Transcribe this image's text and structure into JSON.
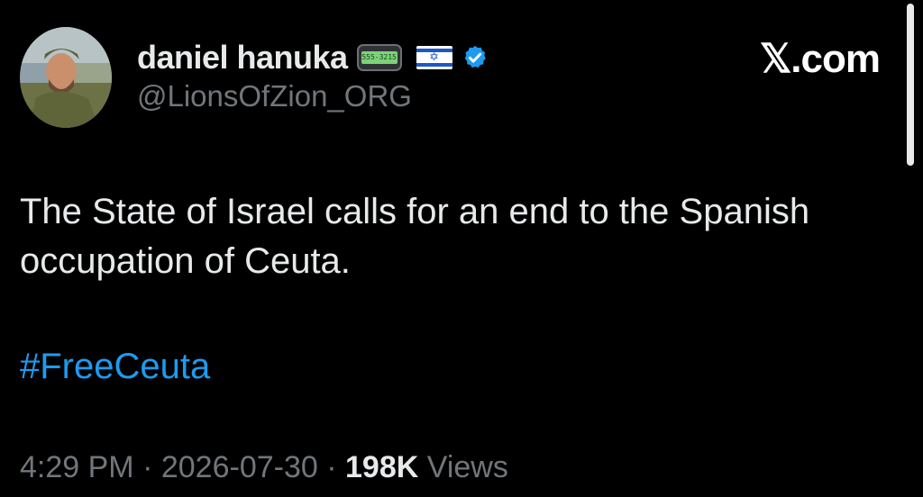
{
  "author": {
    "display_name": "daniel hanuka",
    "handle": "@LionsOfZion_ORG",
    "pager_screen_text": "555-3215",
    "emojis": [
      "pager-icon",
      "israel-flag-icon"
    ],
    "verified_icon": "verified-badge-icon",
    "verified_color": "#1d9bf0"
  },
  "source_logo": "𝕏.com",
  "tweet": {
    "text": "The State of Israel calls for an end to the Spanish occupation of Ceuta.",
    "hashtag": "#FreeCeuta"
  },
  "meta": {
    "time": "4:29 PM",
    "separator": "·",
    "date": "2026-07-30",
    "views_count": "198K",
    "views_label": "Views"
  },
  "colors": {
    "background": "#000000",
    "primary_text": "#e7e9ea",
    "secondary_text": "#71767b",
    "link": "#1d9bf0"
  }
}
